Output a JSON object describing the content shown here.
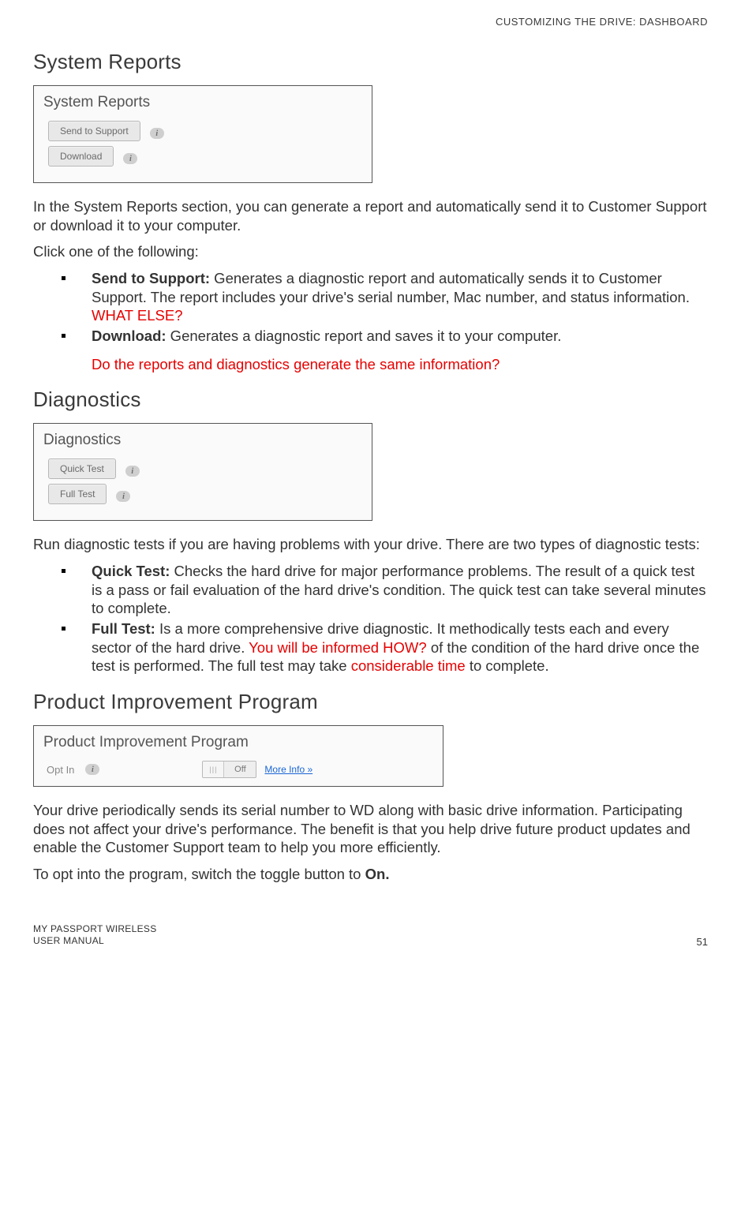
{
  "header": {
    "breadcrumb": "CUSTOMIZING THE DRIVE: DASHBOARD"
  },
  "systemReports": {
    "title": "System Reports",
    "panelTitle": "System Reports",
    "buttons": {
      "sendToSupport": "Send to Support",
      "download": "Download"
    },
    "intro": "In the System Reports section, you can generate a report and automatically send it to Customer Support or download it to your computer.",
    "clickOne": "Click one of the following:",
    "items": {
      "sendTerm": "Send to Support:",
      "sendDesc": " Generates a diagnostic report and automatically sends it to Customer Support. The report includes your drive's serial number, Mac number, and status information. ",
      "sendRed": "WHAT ELSE?",
      "downloadTerm": "Download:",
      "downloadDesc": " Generates a diagnostic report and saves it to your computer.",
      "question": "Do the reports and diagnostics generate the same information?"
    }
  },
  "diagnostics": {
    "title": "Diagnostics",
    "panelTitle": "Diagnostics",
    "buttons": {
      "quick": "Quick Test",
      "full": "Full Test"
    },
    "intro": "Run diagnostic tests if you are having problems with your drive. There are two types of diagnostic tests:",
    "items": {
      "quickTerm": "Quick Test:",
      "quickDesc": " Checks the hard drive for major performance problems. The result of a quick test is a pass or fail evaluation of the hard drive's condition. The quick test can take several minutes to complete.",
      "fullTerm": "Full Test:",
      "fullPart1": " Is a more comprehensive drive diagnostic. It methodically tests each and every sector of the hard drive. ",
      "fullRed1": "You will be informed HOW?",
      "fullPart2": " of the condition of the hard drive once the test is performed. The full test may take ",
      "fullRed2": "considerable time",
      "fullPart3": " to complete."
    }
  },
  "pip": {
    "title": "Product Improvement Program",
    "panelTitle": "Product Improvement Program",
    "optInLabel": "Opt In",
    "toggleState": "Off",
    "moreInfo": "More Info »",
    "para1": "Your drive periodically sends its serial number to WD along with basic drive information. Participating does not affect your drive's performance. The benefit is that you help drive future product updates and enable the Customer Support team to help you more efficiently.",
    "para2a": "To opt into the program, switch the toggle button to ",
    "para2b": "On."
  },
  "footer": {
    "line1": "MY PASSPORT WIRELESS",
    "line2": "USER MANUAL",
    "pageNumber": "51"
  }
}
